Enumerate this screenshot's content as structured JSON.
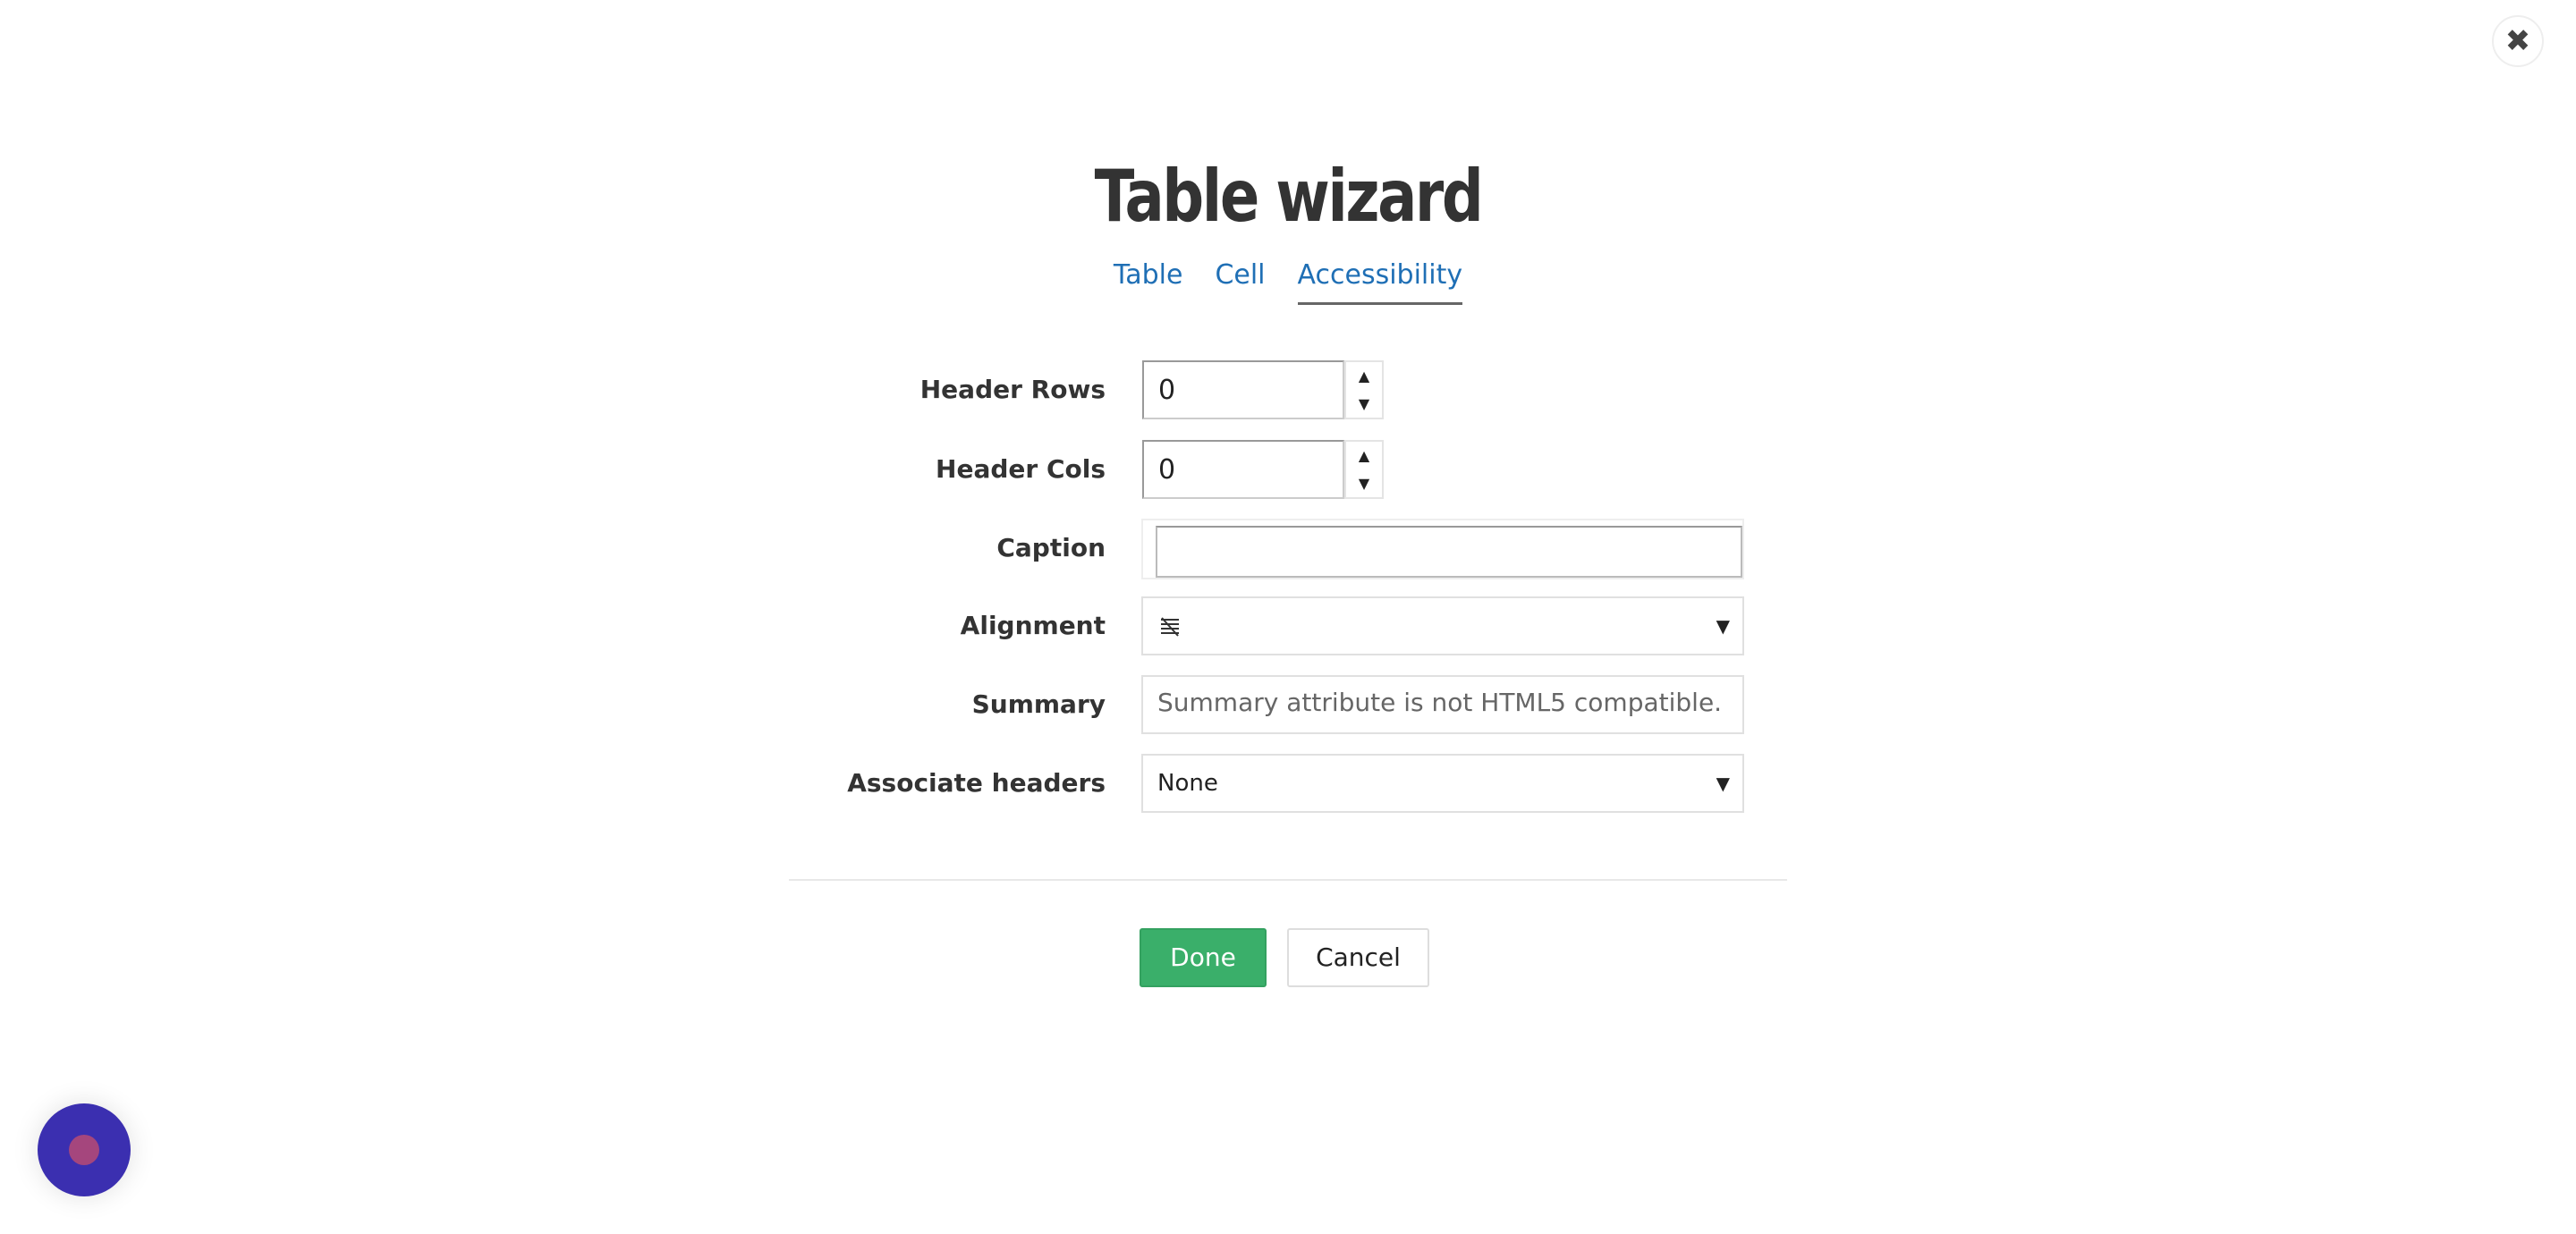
{
  "dialog": {
    "title": "Table wizard",
    "close_icon": "close-icon",
    "close_glyph": "✖"
  },
  "tabs": [
    {
      "label": "Table",
      "active": false
    },
    {
      "label": "Cell",
      "active": false
    },
    {
      "label": "Accessibility",
      "active": true
    }
  ],
  "form": {
    "header_rows": {
      "label": "Header Rows",
      "value": "0"
    },
    "header_cols": {
      "label": "Header Cols",
      "value": "0"
    },
    "caption": {
      "label": "Caption",
      "value": ""
    },
    "alignment": {
      "label": "Alignment",
      "icon": "no-alignment-icon"
    },
    "summary": {
      "label": "Summary",
      "placeholder": "Summary attribute is not HTML5 compatible."
    },
    "associate_headers": {
      "label": "Associate headers",
      "value": "None"
    }
  },
  "spinner": {
    "up": "▲",
    "down": "▼"
  },
  "select_caret": "▼",
  "buttons": {
    "done": "Done",
    "cancel": "Cancel"
  },
  "colors": {
    "link": "#1f6fb5",
    "done_green": "#3aaf6a",
    "chat_bubble": "#3b2fb0",
    "chat_dot": "#a5467d"
  }
}
